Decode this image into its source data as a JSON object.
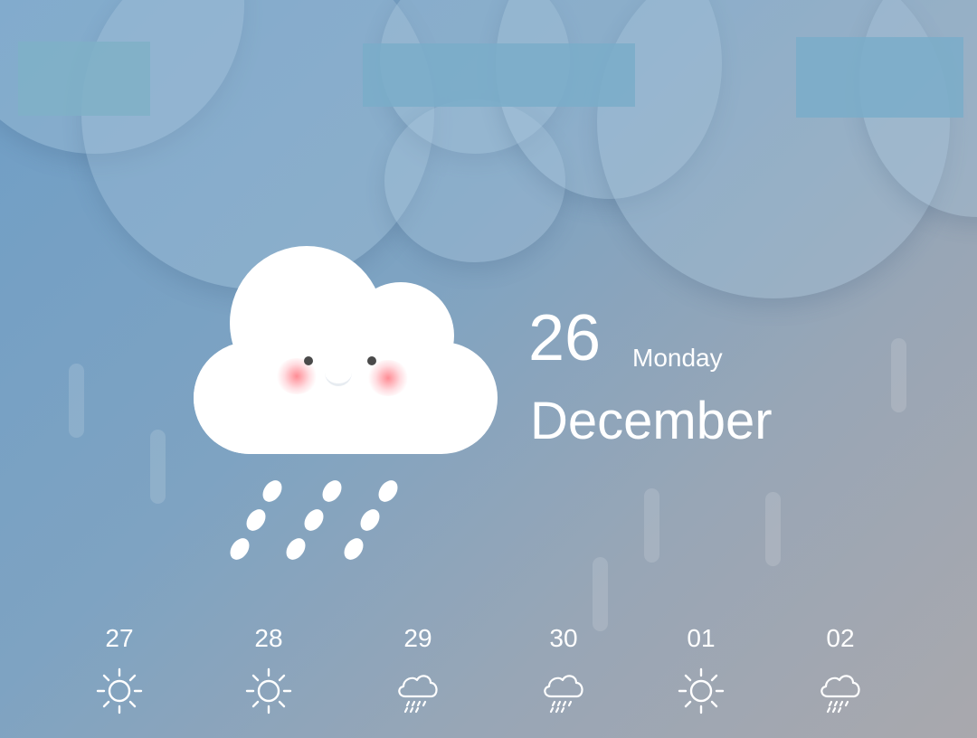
{
  "current": {
    "day": "26",
    "weekday": "Monday",
    "month": "December",
    "condition": "rain"
  },
  "icons": {
    "mascot": "smiling-rain-cloud",
    "sunny": "sun-icon",
    "rainy": "rain-cloud-icon"
  },
  "colors": {
    "background_start": "#6f9ec6",
    "background_end": "#a9a8ad",
    "text": "#ffffff",
    "banner": "#7aadc9"
  },
  "forecast": [
    {
      "date": "27",
      "condition": "sunny"
    },
    {
      "date": "28",
      "condition": "sunny"
    },
    {
      "date": "29",
      "condition": "rainy"
    },
    {
      "date": "30",
      "condition": "rainy"
    },
    {
      "date": "01",
      "condition": "sunny"
    },
    {
      "date": "02",
      "condition": "rainy"
    }
  ]
}
